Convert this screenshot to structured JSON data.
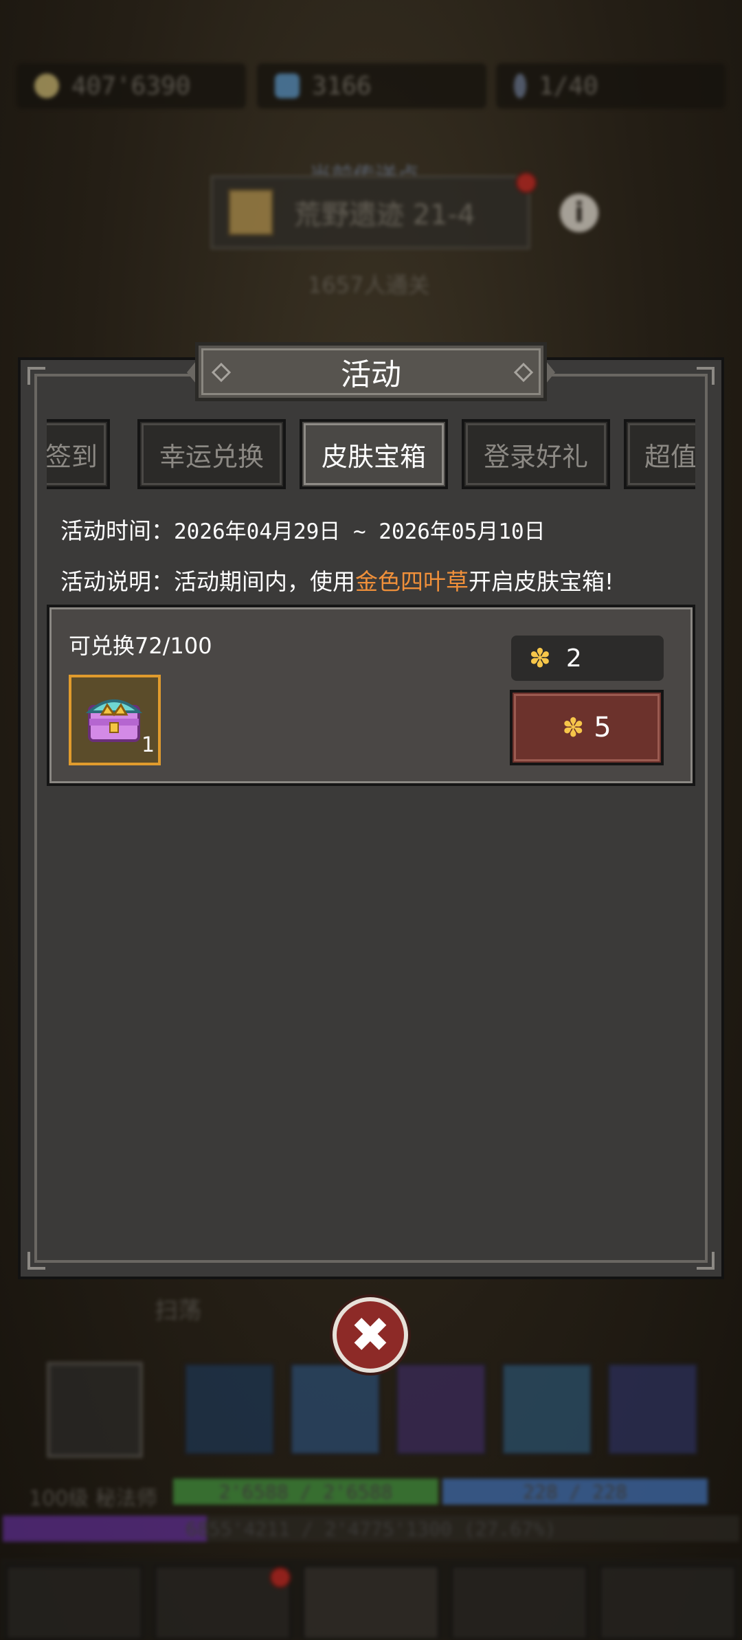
{
  "background": {
    "gold": "407'6390",
    "gems": "3166",
    "keys": "1/40",
    "portal_label": "当前传送点",
    "portal_name": "荒野遗迹 21-4",
    "pass_count": "1657人通关",
    "cleanup_label": "扫荡",
    "level_class": "100级 秘法师",
    "hp_text": "2'6588 / 2'6588",
    "mp_text": "228 / 228",
    "exp_text": "6855'4211 / 2'4775'1300 (27.67%)"
  },
  "modal": {
    "title": "活动",
    "tabs": [
      {
        "label": "签到",
        "active": false
      },
      {
        "label": "幸运兑换",
        "active": false
      },
      {
        "label": "皮肤宝箱",
        "active": true
      },
      {
        "label": "登录好礼",
        "active": false
      },
      {
        "label": "超值",
        "active": false
      }
    ],
    "time_label": "活动时间：",
    "time_value": "2026年04月29日 ~ 2026年05月10日",
    "desc_label": "活动说明：",
    "desc_before": "活动期间内，使用",
    "desc_highlight": "金色四叶草",
    "desc_after": "开启皮肤宝箱!",
    "card": {
      "count_text": "可兑换72/100",
      "item_icon": "skin-chest-icon",
      "item_qty": "1",
      "owned": "2",
      "price": "5"
    }
  },
  "colors": {
    "highlight": "#f0903a",
    "buy_button": "#6c322c",
    "item_border": "#e09b2d",
    "close_button": "#8d2a27"
  }
}
